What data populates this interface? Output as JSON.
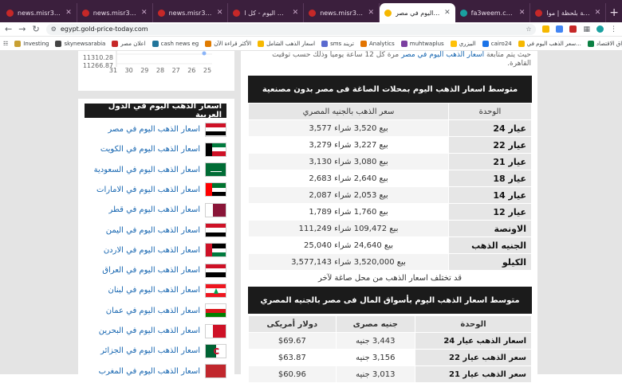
{
  "browser": {
    "tabs": [
      {
        "title": "news.misr365.com/wp-co",
        "color": "#c62828",
        "active": false
      },
      {
        "title": "news.misr365.com/wp-co",
        "color": "#c62828",
        "active": false
      },
      {
        "title": "news.misr365.com/wp-co",
        "color": "#c62828",
        "active": false
      },
      {
        "title": "اسعار العملات اليوم - كل ا",
        "color": "#c62828",
        "active": false
      },
      {
        "title": "news.misr365.com/wp-co",
        "color": "#c62828",
        "active": false
      },
      {
        "title": "سعر الذهب اليوم في مصر",
        "color": "#f6b800",
        "active": true
      },
      {
        "title": "fa3weem.com",
        "color": "#1aa0a0",
        "active": false
      },
      {
        "title": "نشرة لحظة بلحظة | موا",
        "color": "#c62828",
        "active": false
      }
    ],
    "new_tab": "+",
    "url": "egypt.gold-price-today.com",
    "bookmarks": [
      {
        "label": "Investing",
        "color": "#c8a033"
      },
      {
        "label": "skynewsarabia",
        "color": "#444444"
      },
      {
        "label": "اعلان مصر",
        "color": "#c62828"
      },
      {
        "label": "cash news eg",
        "color": "#21759b"
      },
      {
        "label": "الأكثر قراءة الآن",
        "color": "#e07b00"
      },
      {
        "label": "اسعار الذهب الشامل",
        "color": "#f6b800"
      },
      {
        "label": "sms تريند",
        "color": "#5a6acf"
      },
      {
        "label": "Analytics",
        "color": "#e37400"
      },
      {
        "label": "muhtwaplus",
        "color": "#7b3fa0"
      },
      {
        "label": "البيزري",
        "color": "#ffc107"
      },
      {
        "label": "cairo24",
        "color": "#1a73e8"
      },
      {
        "label": "سعر الذهب اليوم في...",
        "color": "#f6b800"
      },
      {
        "label": "أسواق الاقتصاد",
        "color": "#0b8043"
      }
    ]
  },
  "chart_stub": {
    "y_ticks": [
      "11310.28",
      "11266.87"
    ],
    "x_ticks": [
      "31",
      "30",
      "29",
      "28",
      "27",
      "26",
      "25"
    ]
  },
  "sidebar": {
    "title": "اسعار الذهب اليوم في الدول العربية",
    "items": [
      {
        "label": "اسعار الذهب اليوم في مصر",
        "flag": "egypt"
      },
      {
        "label": "اسعار الذهب اليوم في الكويت",
        "flag": "kuwait"
      },
      {
        "label": "اسعار الذهب اليوم في السعودية",
        "flag": "saudi"
      },
      {
        "label": "اسعار الذهب اليوم في الامارات",
        "flag": "uae"
      },
      {
        "label": "اسعار الذهب اليوم في قطر",
        "flag": "qatar"
      },
      {
        "label": "اسعار الذهب اليوم في اليمن",
        "flag": "yemen"
      },
      {
        "label": "اسعار الذهب اليوم في الاردن",
        "flag": "jordan"
      },
      {
        "label": "اسعار الذهب اليوم في العراق",
        "flag": "iraq"
      },
      {
        "label": "اسعار الذهب اليوم في لبنان",
        "flag": "lebanon"
      },
      {
        "label": "اسعار الذهب اليوم في عمان",
        "flag": "oman"
      },
      {
        "label": "اسعار الذهب اليوم في البحرين",
        "flag": "bahrain"
      },
      {
        "label": "اسعار الذهب اليوم في الجزائر",
        "flag": "algeria"
      },
      {
        "label": "اسعار الذهب اليوم في المغرب",
        "flag": "morocco"
      }
    ]
  },
  "intro": {
    "line1_pre": "حيث يتم متابعة ",
    "line1_link": "اسعار الذهب اليوم في مصر",
    "line1_post": " مرة كل 12 ساعة يوميا وذلك حسب توقيت",
    "line2": "القاهرة."
  },
  "table1": {
    "heading": "متوسط اسعار الذهب اليوم بمحلات الصاغة فى مصر بدون مصنعية",
    "col_unit": "الوحدة",
    "col_price": "سعر الذهب بالجنيه المصري",
    "rows": [
      {
        "unit": "عيار 24",
        "price": "بيع 3,520 شراء 3,577"
      },
      {
        "unit": "عيار 22",
        "price": "بيع 3,227 شراء 3,279"
      },
      {
        "unit": "عيار 21",
        "price": "بيع 3,080 شراء 3,130"
      },
      {
        "unit": "عيار 18",
        "price": "بيع 2,640 شراء 2,683"
      },
      {
        "unit": "عيار 14",
        "price": "بيع 2,053 شراء 2,087"
      },
      {
        "unit": "عيار 12",
        "price": "بيع 1,760 شراء 1,789"
      },
      {
        "unit": "الاونصة",
        "price": "بيع 109,472 شراء 111,249"
      },
      {
        "unit": "الجنيه الذهب",
        "price": "بيع 24,640 شراء 25,040"
      },
      {
        "unit": "الكيلو",
        "price": "بيع 3,520,000 شراء 3,577,143"
      }
    ],
    "note": "قد تختلف اسعار الذهب من محل صاغة لآخر"
  },
  "table2": {
    "heading": "متوسط اسعار الذهب اليوم بأسواق المال فى مصر بالجنيه المصري",
    "col_unit": "الوحدة",
    "col_egp": "جنيه مصرى",
    "col_usd": "دولار أمريكى",
    "rows": [
      {
        "unit": "اسعار الذهب عيار 24",
        "egp": "3,443 جنيه",
        "usd": "$69.67"
      },
      {
        "unit": "سعر الذهب عيار 22",
        "egp": "3,156 جنيه",
        "usd": "$63.87"
      },
      {
        "unit": "سعر الذهب عيار 21",
        "egp": "3,013 جنيه",
        "usd": "$60.96"
      }
    ]
  }
}
